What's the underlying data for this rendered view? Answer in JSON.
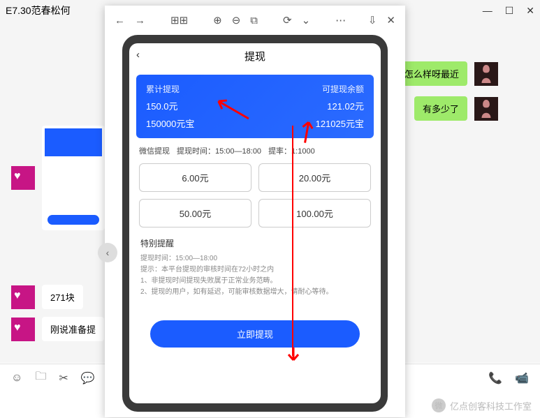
{
  "window": {
    "title": "E7.30范春松何"
  },
  "chat": {
    "out1": "挂的怎么样呀最近",
    "out2": "有多少了",
    "in1": "271块",
    "in2": "刚说准备提"
  },
  "phone": {
    "title": "提现",
    "card": {
      "left_label": "累计提现",
      "right_label": "可提现余额",
      "left_val1": "150.0元",
      "right_val1": "121.02元",
      "left_val2": "150000元宝",
      "right_val2": "121025元宝"
    },
    "info": {
      "method": "微信提现",
      "time": "提现时间：15:00—18:00",
      "rate": "提率：1:1000"
    },
    "amounts": {
      "a1": "6.00元",
      "a2": "20.00元",
      "a3": "50.00元",
      "a4": "100.00元"
    },
    "notice": {
      "header": "特别提醒",
      "l1": "提现时间：15:00—18:00",
      "l2": "提示：本平台提现的审核时间在72小时之内",
      "l3": "1、非提现时间提现失败属于正常业务范畴。",
      "l4": "2、提现的用户，如有延迟，可能审核数据增大，请耐心等待。"
    },
    "button": "立即提现"
  },
  "watermark": "亿点创客科技工作室"
}
